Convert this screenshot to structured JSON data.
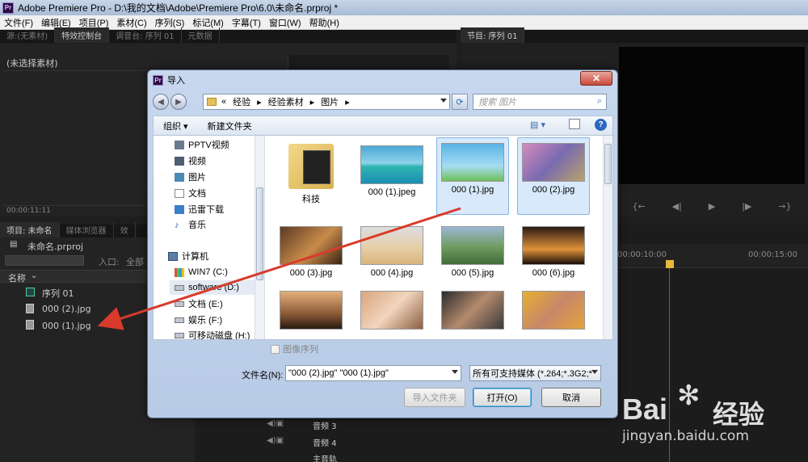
{
  "app": {
    "title": "Adobe Premiere Pro - D:\\我的文档\\Adobe\\Premiere Pro\\6.0\\未命名.prproj *",
    "logo_text": "Pr"
  },
  "menu": [
    "文件(F)",
    "编辑(E)",
    "项目(P)",
    "素材(C)",
    "序列(S)",
    "标记(M)",
    "字幕(T)",
    "窗口(W)",
    "帮助(H)"
  ],
  "panels": {
    "source_tabs": [
      "源:(无素材)",
      "特效控制台",
      "调音台: 序列 01",
      "元数据"
    ],
    "effect_no_clip": "(未选择素材)",
    "source_time": "00:00:11:11",
    "program_tab": "节目: 序列 01",
    "project_tabs": [
      "项目: 未命名",
      "媒体浏览器",
      "效"
    ],
    "project_file": "未命名.prproj",
    "in_point_label": "入口:",
    "in_point_value": "全部",
    "name_header": "名称",
    "project_items": [
      "序列 01",
      "000 (2).jpg",
      "000 (1).jpg"
    ],
    "timecode_1": "00:00:10:00",
    "timecode_2": "00:00:15:00",
    "audio_tracks": [
      "音频 3",
      "音频 4",
      "主音轨"
    ]
  },
  "dialog": {
    "title": "导入",
    "close": "✕",
    "path": [
      "«",
      "经验",
      "经验素材",
      "图片"
    ],
    "search_placeholder": "搜索 图片",
    "organize": "组织 ▾",
    "new_folder": "新建文件夹",
    "nav_items": [
      "PPTV视频",
      "视频",
      "图片",
      "文档",
      "迅雷下载",
      "音乐",
      "计算机",
      "WIN7 (C:)",
      "software (D:)",
      "文档 (E:)",
      "娱乐 (F:)",
      "可移动磁盘 (H:)"
    ],
    "files": [
      {
        "name": "科技",
        "type": "folder"
      },
      {
        "name": "000 (1).jpeg",
        "type": "image"
      },
      {
        "name": "000 (1).jpg",
        "type": "image",
        "selected": true
      },
      {
        "name": "000 (2).jpg",
        "type": "image",
        "selected": true
      },
      {
        "name": "000 (3).jpg",
        "type": "image"
      },
      {
        "name": "000 (4).jpg",
        "type": "image"
      },
      {
        "name": "000 (5).jpg",
        "type": "image"
      },
      {
        "name": "000 (6).jpg",
        "type": "image"
      },
      {
        "name": "",
        "type": "image"
      },
      {
        "name": "",
        "type": "image"
      },
      {
        "name": "",
        "type": "image"
      },
      {
        "name": "",
        "type": "image"
      }
    ],
    "image_sequence": "图像序列",
    "filename_label": "文件名(N):",
    "filename_value": "\"000 (2).jpg\" \"000 (1).jpg\"",
    "filter_value": "所有可支持媒体 (*.264;*.3G2;*",
    "import_folder": "导入文件夹",
    "open": "打开(O)",
    "cancel": "取消"
  },
  "watermark": {
    "brand": "Bai",
    "brand_cn": "经验",
    "url": "jingyan.baidu.com"
  },
  "colors": {
    "annotation_arrow": "#d93a2b",
    "playhead": "#e8b838",
    "selection": "#d8e9fb"
  }
}
